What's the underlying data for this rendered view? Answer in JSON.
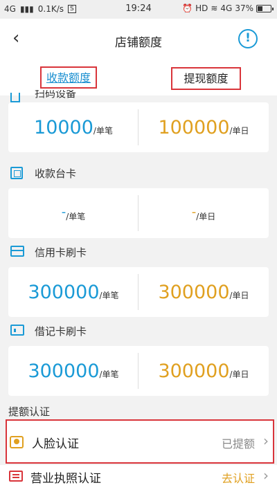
{
  "status_bar": {
    "network": "4G",
    "speed": "0.1K/s",
    "time": "19:24",
    "hd": "HD",
    "network2": "4G",
    "battery": "37%"
  },
  "nav": {
    "title": "店铺额度"
  },
  "tabs": [
    {
      "label": "收款额度"
    },
    {
      "label": "提现额度"
    }
  ],
  "sections": [
    {
      "label": "扫码设备",
      "per_txn": "10000",
      "per_txn_unit": "/单笔",
      "per_day": "100000",
      "per_day_unit": "/单日"
    },
    {
      "label": "收款台卡",
      "per_txn": "-",
      "per_txn_unit": "/单笔",
      "per_day": "-",
      "per_day_unit": "/单日"
    },
    {
      "label": "信用卡刷卡",
      "per_txn": "300000",
      "per_txn_unit": "/单笔",
      "per_day": "300000",
      "per_day_unit": "/单日"
    },
    {
      "label": "借记卡刷卡",
      "per_txn": "300000",
      "per_txn_unit": "/单笔",
      "per_day": "300000",
      "per_day_unit": "/单日"
    }
  ],
  "auth": {
    "title": "提额认证",
    "items": [
      {
        "label": "人脸认证",
        "status": "已提额"
      },
      {
        "label": "营业执照认证",
        "status": "去认证"
      }
    ]
  },
  "colors": {
    "accent_blue": "#1a9ad6",
    "accent_orange": "#e0a020",
    "highlight_red": "#d9343a"
  }
}
